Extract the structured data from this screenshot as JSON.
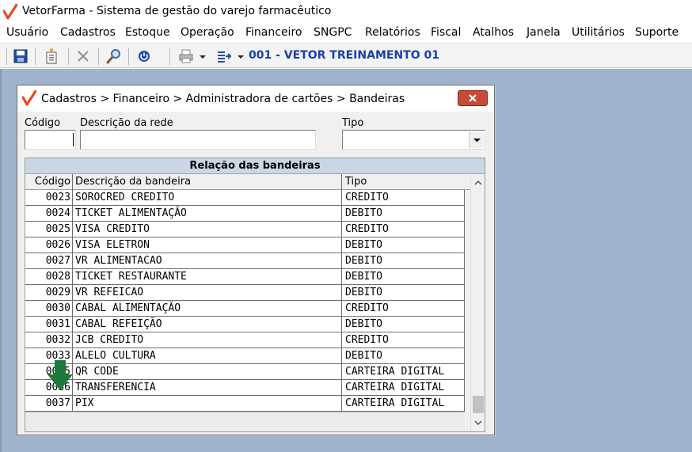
{
  "app": {
    "title": "VetorFarma - Sistema de gestão do varejo farmacêutico"
  },
  "menu": [
    "Usuário",
    "Cadastros",
    "Estoque",
    "Operação",
    "Financeiro",
    "SNGPC",
    "Relatórios",
    "Fiscal",
    "Atalhos",
    "Janela",
    "Utilitários",
    "Suporte"
  ],
  "toolbar": {
    "icons": [
      "save-icon",
      "new-document-icon",
      "cancel-icon",
      "search-icon",
      "power-icon",
      "print-icon",
      "export-icon"
    ],
    "environment_label": "001 - VETOR TREINAMENTO 01"
  },
  "dialog": {
    "title": "Cadastros > Financeiro > Administradora de cartões > Bandeiras",
    "filters": {
      "codigo_label": "Código",
      "codigo_value": "",
      "descricao_label": "Descrição da rede",
      "descricao_value": "",
      "tipo_label": "Tipo",
      "tipo_value": ""
    },
    "grid": {
      "caption": "Relação das bandeiras",
      "columns": [
        "Código",
        "Descrição da bandeira",
        "Tipo"
      ],
      "rows": [
        [
          "0023",
          "SOROCRED CREDITO",
          "CREDITO"
        ],
        [
          "0024",
          "TICKET ALIMENTAÇÃO",
          "DEBITO"
        ],
        [
          "0025",
          "VISA CREDITO",
          "CREDITO"
        ],
        [
          "0026",
          "VISA ELETRON",
          "DEBITO"
        ],
        [
          "0027",
          "VR ALIMENTACAO",
          "DEBITO"
        ],
        [
          "0028",
          "TICKET RESTAURANTE",
          "DEBITO"
        ],
        [
          "0029",
          "VR REFEICAO",
          "DEBITO"
        ],
        [
          "0030",
          "CABAL ALIMENTAÇÃO",
          "CREDITO"
        ],
        [
          "0031",
          "CABAL REFEIÇÃO",
          "DEBITO"
        ],
        [
          "0032",
          "JCB CREDITO",
          "CREDITO"
        ],
        [
          "0033",
          "ALELO CULTURA",
          "DEBITO"
        ],
        [
          "0035",
          "QR CODE",
          "CARTEIRA DIGITAL"
        ],
        [
          "0036",
          "TRANSFERENCIA",
          "CARTEIRA DIGITAL"
        ],
        [
          "0037",
          "PIX",
          "CARTEIRA DIGITAL"
        ]
      ]
    }
  },
  "colors": {
    "logo": "#e8491d",
    "environment": "#1a3fb0",
    "mdi_background": "#9fb4cc",
    "close_button": "#c94a36",
    "arrow": "#1e7a3c"
  }
}
